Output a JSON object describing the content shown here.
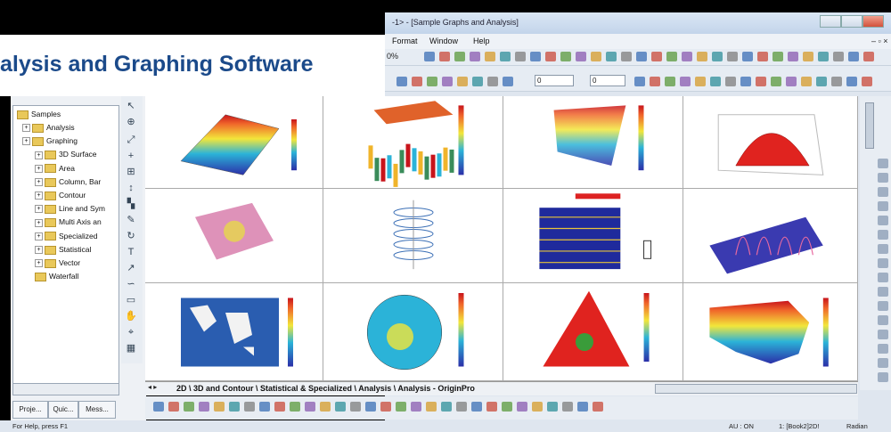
{
  "window": {
    "title": "-1> - [Sample Graphs and Analysis]"
  },
  "banner": {
    "text": "alysis and Graphing Software"
  },
  "menu": [
    "Format",
    "Window",
    "Help"
  ],
  "toolbar": {
    "zoom": "0%",
    "line_width": "0",
    "fill": "0"
  },
  "tree": {
    "root": "Samples",
    "items": [
      {
        "label": "Analysis",
        "level": 1
      },
      {
        "label": "Graphing",
        "level": 1
      },
      {
        "label": "3D Surface",
        "level": 2
      },
      {
        "label": "Area",
        "level": 2
      },
      {
        "label": "Column, Bar",
        "level": 2
      },
      {
        "label": "Contour",
        "level": 2
      },
      {
        "label": "Line and Sym",
        "level": 2
      },
      {
        "label": "Multi Axis an",
        "level": 2
      },
      {
        "label": "Specialized",
        "level": 2
      },
      {
        "label": "Statistical",
        "level": 2
      },
      {
        "label": "Vector",
        "level": 2
      },
      {
        "label": "Waterfall",
        "level": 2
      }
    ]
  },
  "panel_tabs": [
    "Proje...",
    "Quic...",
    "Mess..."
  ],
  "sheet_tabs": "2D \\ 3D and Contour \\ Statistical & Specialized \\ Analysis \\ Analysis - OriginPro",
  "status": {
    "help": "For Help, press F1",
    "au": "AU : ON",
    "book": "1: [Book2]2D!",
    "unit": "Radian"
  },
  "colors": {
    "banner_text": "#1b4a8a",
    "window_chrome": "#dfe6ef",
    "accent": "#2a5db0"
  }
}
